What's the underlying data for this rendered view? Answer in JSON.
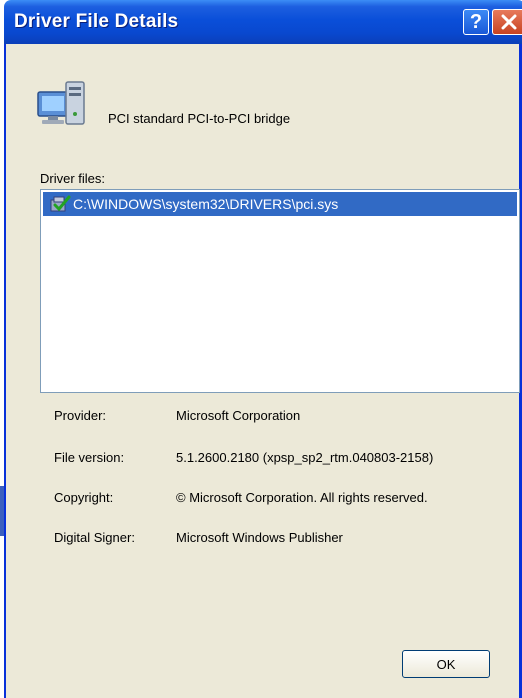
{
  "window": {
    "title": "Driver File Details",
    "help_glyph": "?",
    "close_glyph": "×"
  },
  "device": {
    "name": "PCI standard PCI-to-PCI bridge",
    "icon": "computer-icon"
  },
  "files": {
    "label": "Driver files:",
    "items": [
      {
        "path": "C:\\WINDOWS\\system32\\DRIVERS\\pci.sys",
        "icon": "signed-file-icon"
      }
    ]
  },
  "details": {
    "provider_label": "Provider:",
    "provider_value": "Microsoft Corporation",
    "version_label": "File version:",
    "version_value": "5.1.2600.2180 (xpsp_sp2_rtm.040803-2158)",
    "copyright_label": "Copyright:",
    "copyright_value": "© Microsoft Corporation. All rights reserved.",
    "signer_label": "Digital Signer:",
    "signer_value": "Microsoft Windows Publisher"
  },
  "buttons": {
    "ok_label": "OK"
  },
  "colors": {
    "titlebar": "#0a4fd9",
    "selection": "#316ac5",
    "dialog_bg": "#ece9d8"
  }
}
